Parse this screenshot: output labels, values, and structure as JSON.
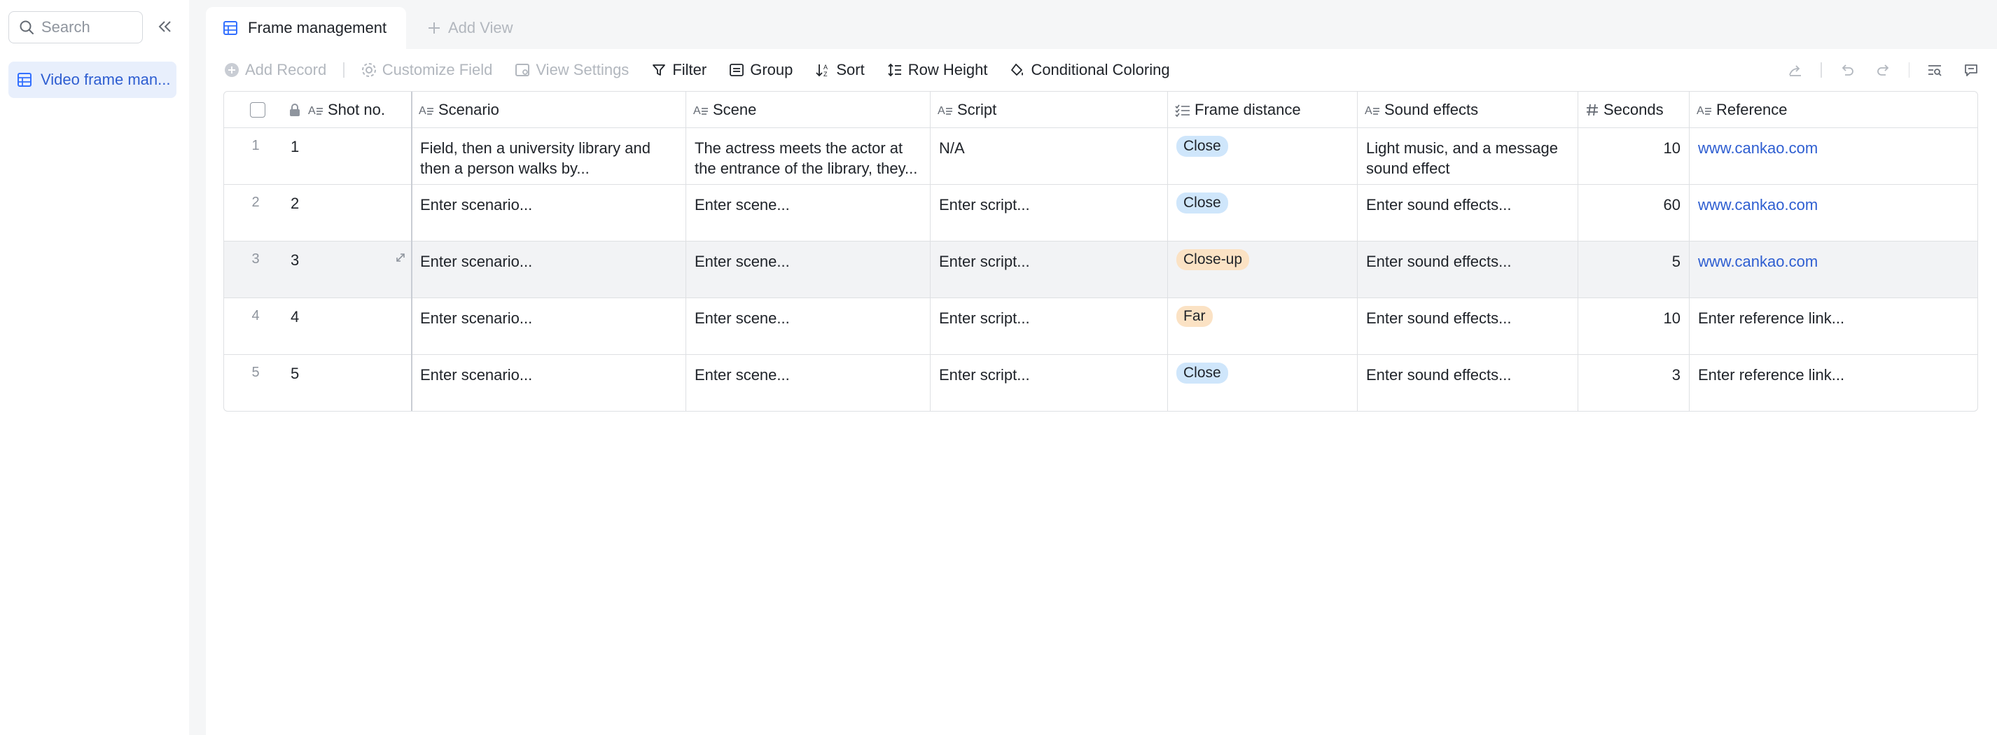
{
  "sidebar": {
    "search_placeholder": "Search",
    "items": [
      {
        "label": "Video frame man..."
      }
    ]
  },
  "tabs": {
    "active_label": "Frame management",
    "add_view_label": "Add View"
  },
  "toolbar": {
    "add_record": "Add Record",
    "customize_field": "Customize Field",
    "view_settings": "View Settings",
    "filter": "Filter",
    "group": "Group",
    "sort": "Sort",
    "row_height": "Row Height",
    "conditional_coloring": "Conditional Coloring"
  },
  "grid": {
    "columns": [
      "Shot no.",
      "Scenario",
      "Scene",
      "Script",
      "Frame distance",
      "Sound effects",
      "Seconds",
      "Reference"
    ],
    "rows": [
      {
        "num": "1",
        "shot": "1",
        "scenario": "Field, then a university library and then a person walks by...",
        "scene": "The actress meets the actor at the entrance of the library, they...",
        "script": "N/A",
        "frame": "Close",
        "sound": "Light music, and a message sound effect",
        "seconds": "10",
        "reference": "www.cankao.com"
      },
      {
        "num": "2",
        "shot": "2",
        "scenario": "Enter scenario...",
        "scene": "Enter scene...",
        "script": "Enter script...",
        "frame": "Close",
        "sound": "Enter sound effects...",
        "seconds": "60",
        "reference": "www.cankao.com"
      },
      {
        "num": "3",
        "shot": "3",
        "scenario": "Enter scenario...",
        "scene": "Enter scene...",
        "script": "Enter script...",
        "frame": "Close-up",
        "sound": "Enter sound effects...",
        "seconds": "5",
        "reference": "www.cankao.com"
      },
      {
        "num": "4",
        "shot": "4",
        "scenario": "Enter scenario...",
        "scene": "Enter scene...",
        "script": "Enter script...",
        "frame": "Far",
        "sound": "Enter sound effects...",
        "seconds": "10",
        "reference": "Enter reference link..."
      },
      {
        "num": "5",
        "shot": "5",
        "scenario": "Enter scenario...",
        "scene": "Enter scene...",
        "script": "Enter script...",
        "frame": "Close",
        "sound": "Enter sound effects...",
        "seconds": "3",
        "reference": "Enter reference link..."
      }
    ]
  },
  "colors": {
    "accent": "#3370ff",
    "tag_close": "#cfe6fb",
    "tag_closeup": "#fbe2c4",
    "tag_far": "#fbe2c4",
    "link": "#2e5ed1"
  }
}
